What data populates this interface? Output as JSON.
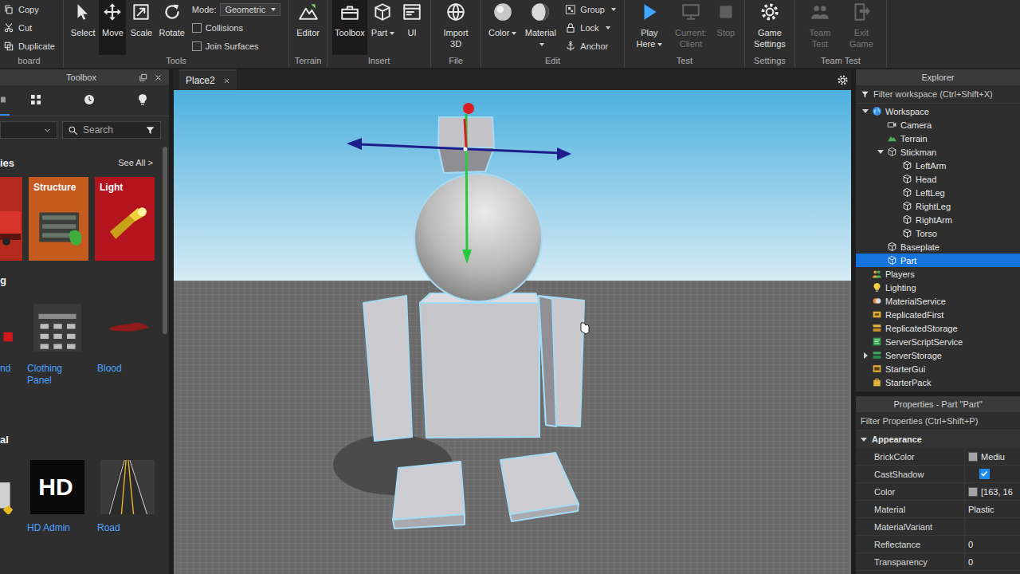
{
  "ribbon": {
    "groups": [
      {
        "label": "board",
        "items": [
          {
            "kind": "small",
            "label": "Copy",
            "dropdown": false
          },
          {
            "kind": "small",
            "label": "Cut",
            "dropdown": false
          },
          {
            "kind": "small",
            "label": "Duplicate",
            "dropdown": false
          }
        ]
      },
      {
        "label": "Tools",
        "items": [
          {
            "kind": "big",
            "label": "Select",
            "selected": false,
            "disabled": false,
            "dropdown": false
          },
          {
            "kind": "big",
            "label": "Move",
            "selected": true,
            "disabled": false,
            "dropdown": false
          },
          {
            "kind": "big",
            "label": "Scale",
            "selected": false,
            "disabled": false,
            "dropdown": false
          },
          {
            "kind": "big",
            "label": "Rotate",
            "selected": false,
            "disabled": false,
            "dropdown": false
          },
          {
            "kind": "dropdown",
            "label": "Mode:",
            "value": "Geometric"
          },
          {
            "kind": "check",
            "label": "Collisions",
            "checked": false
          },
          {
            "kind": "check",
            "label": "Join Surfaces",
            "checked": false
          }
        ]
      },
      {
        "label": "Terrain",
        "items": [
          {
            "kind": "big",
            "label": "Editor",
            "selected": false,
            "disabled": false,
            "dropdown": false
          }
        ]
      },
      {
        "label": "Insert",
        "items": [
          {
            "kind": "big",
            "label": "Toolbox",
            "selected": true,
            "disabled": false,
            "dropdown": false
          },
          {
            "kind": "big",
            "label": "Part",
            "selected": false,
            "disabled": false,
            "dropdown": true
          },
          {
            "kind": "big",
            "label": "UI",
            "selected": false,
            "disabled": false,
            "dropdown": false
          }
        ]
      },
      {
        "label": "File",
        "items": [
          {
            "kind": "big",
            "label": "Import 3D",
            "selected": false,
            "disabled": false,
            "dropdown": false
          }
        ]
      },
      {
        "label": "Edit",
        "items": [
          {
            "kind": "big",
            "label": "Color",
            "selected": false,
            "disabled": false,
            "dropdown": true
          },
          {
            "kind": "big",
            "label": "Material",
            "selected": false,
            "disabled": false,
            "dropdown": true
          },
          {
            "kind": "small",
            "label": "Group",
            "dropdown": true
          },
          {
            "kind": "small",
            "label": "Lock",
            "dropdown": true
          },
          {
            "kind": "small",
            "label": "Anchor",
            "dropdown": false
          }
        ]
      },
      {
        "label": "Test",
        "items": [
          {
            "kind": "big",
            "label": "Play Here",
            "selected": false,
            "disabled": false,
            "dropdown": true
          },
          {
            "kind": "big",
            "label": "Current: Client",
            "selected": false,
            "disabled": true,
            "dropdown": false
          },
          {
            "kind": "big",
            "label": "Stop",
            "selected": false,
            "disabled": true,
            "dropdown": false
          }
        ]
      },
      {
        "label": "Settings",
        "items": [
          {
            "kind": "big",
            "label": "Game Settings",
            "selected": false,
            "disabled": false,
            "dropdown": false
          }
        ]
      },
      {
        "label": "Team Test",
        "items": [
          {
            "kind": "big",
            "label": "Team Test",
            "selected": false,
            "disabled": true,
            "dropdown": false
          },
          {
            "kind": "big",
            "label": "Exit Game",
            "selected": false,
            "disabled": true,
            "dropdown": false
          }
        ]
      }
    ]
  },
  "toolbox": {
    "title": "Toolbox",
    "tabs": [
      {
        "selected": true
      },
      {
        "selected": false
      },
      {
        "selected": false
      },
      {
        "selected": false
      }
    ],
    "search": {
      "placeholder": "Search"
    },
    "categories": {
      "title": "ies",
      "link": "See All >",
      "cards": [
        {
          "label": "",
          "color": "#b52a1f"
        },
        {
          "label": "Structure",
          "color": "#c55a1e"
        },
        {
          "label": "Light",
          "color": "#b3141e"
        }
      ]
    },
    "sections": [
      {
        "title": "g",
        "items": [
          {
            "label": "nd"
          },
          {
            "label": "Clothing Panel"
          },
          {
            "label": "Blood"
          }
        ]
      },
      {
        "title": "al",
        "items": [
          {
            "label": ""
          },
          {
            "label": "HD Admin",
            "thumb_text": "HD"
          },
          {
            "label": "Road"
          }
        ]
      }
    ]
  },
  "viewport": {
    "tab": {
      "label": "Place2"
    }
  },
  "explorer": {
    "title": "Explorer",
    "filter": {
      "placeholder": "Filter workspace (Ctrl+Shift+X)"
    },
    "items": [
      {
        "label": "Workspace",
        "kind": "workspace",
        "expandable": true,
        "expanded": true,
        "selected": false,
        "children": [
          {
            "label": "Camera",
            "kind": "camera",
            "expandable": false,
            "expanded": false,
            "selected": false,
            "children": []
          },
          {
            "label": "Terrain",
            "kind": "terrain",
            "expandable": false,
            "expanded": false,
            "selected": false,
            "children": []
          },
          {
            "label": "Stickman",
            "kind": "model",
            "expandable": true,
            "expanded": true,
            "selected": false,
            "children": [
              {
                "label": "LeftArm",
                "kind": "part",
                "expandable": false,
                "expanded": false,
                "selected": false,
                "children": []
              },
              {
                "label": "Head",
                "kind": "part",
                "expandable": false,
                "expanded": false,
                "selected": false,
                "children": []
              },
              {
                "label": "LeftLeg",
                "kind": "part",
                "expandable": false,
                "expanded": false,
                "selected": false,
                "children": []
              },
              {
                "label": "RightLeg",
                "kind": "part",
                "expandable": false,
                "expanded": false,
                "selected": false,
                "children": []
              },
              {
                "label": "RightArm",
                "kind": "part",
                "expandable": false,
                "expanded": false,
                "selected": false,
                "children": []
              },
              {
                "label": "Torso",
                "kind": "part",
                "expandable": false,
                "expanded": false,
                "selected": false,
                "children": []
              }
            ]
          },
          {
            "label": "Baseplate",
            "kind": "part",
            "expandable": false,
            "expanded": false,
            "selected": false,
            "children": []
          },
          {
            "label": "Part",
            "kind": "part",
            "expandable": false,
            "expanded": false,
            "selected": true,
            "children": []
          }
        ]
      },
      {
        "label": "Players",
        "kind": "players",
        "expandable": false,
        "expanded": false,
        "selected": false,
        "children": []
      },
      {
        "label": "Lighting",
        "kind": "lighting",
        "expandable": false,
        "expanded": false,
        "selected": false,
        "children": []
      },
      {
        "label": "MaterialService",
        "kind": "material-service",
        "expandable": false,
        "expanded": false,
        "selected": false,
        "children": []
      },
      {
        "label": "ReplicatedFirst",
        "kind": "replicated-first",
        "expandable": false,
        "expanded": false,
        "selected": false,
        "children": []
      },
      {
        "label": "ReplicatedStorage",
        "kind": "replicated-storage",
        "expandable": false,
        "expanded": false,
        "selected": false,
        "children": []
      },
      {
        "label": "ServerScriptService",
        "kind": "script-service",
        "expandable": false,
        "expanded": false,
        "selected": false,
        "children": []
      },
      {
        "label": "ServerStorage",
        "kind": "storage",
        "expandable": true,
        "expanded": false,
        "selected": false,
        "children": []
      },
      {
        "label": "StarterGui",
        "kind": "gui",
        "expandable": false,
        "expanded": false,
        "selected": false,
        "children": []
      },
      {
        "label": "StarterPack",
        "kind": "pack",
        "expandable": false,
        "expanded": false,
        "selected": false,
        "children": []
      }
    ]
  },
  "properties": {
    "title": "Properties - Part \"Part\"",
    "filter": {
      "placeholder": "Filter Properties (Ctrl+Shift+P)"
    },
    "categories": [
      {
        "label": "Appearance",
        "expanded": true,
        "rows": [
          {
            "name": "BrickColor",
            "kind": "color",
            "value": "Mediu",
            "color": "#a3a2a5",
            "checked": false
          },
          {
            "name": "CastShadow",
            "kind": "check",
            "value": "",
            "color": "",
            "checked": true
          },
          {
            "name": "Color",
            "kind": "color",
            "value": "[163, 16",
            "color": "#a3a2a5",
            "checked": false
          },
          {
            "name": "Material",
            "kind": "text",
            "value": "Plastic",
            "color": "",
            "checked": false
          },
          {
            "name": "MaterialVariant",
            "kind": "text",
            "value": "",
            "color": "",
            "checked": false
          },
          {
            "name": "Reflectance",
            "kind": "text",
            "value": "0",
            "color": "",
            "checked": false
          },
          {
            "name": "Transparency",
            "kind": "text",
            "value": "0",
            "color": "",
            "checked": false
          }
        ]
      }
    ]
  }
}
